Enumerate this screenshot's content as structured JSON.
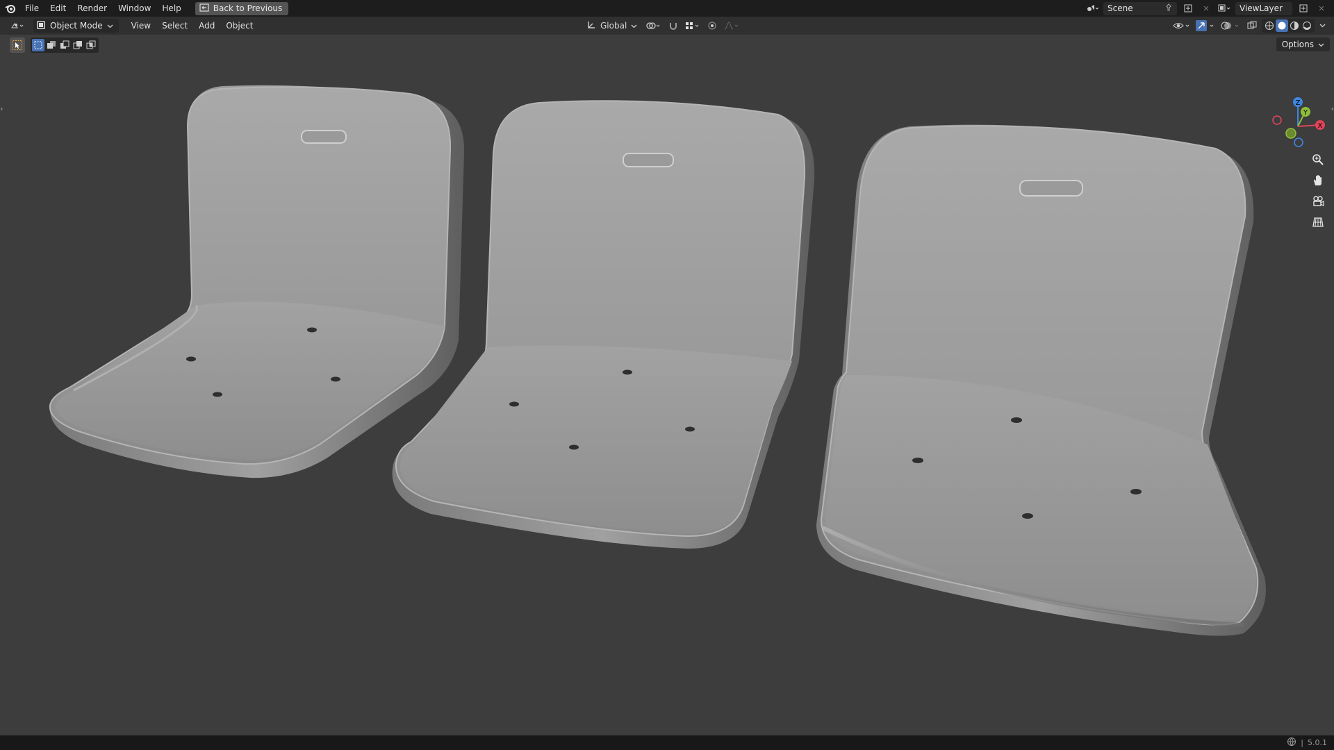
{
  "menu": {
    "items": [
      "File",
      "Edit",
      "Render",
      "Window",
      "Help"
    ],
    "back_button": "Back to Previous"
  },
  "top_right": {
    "scene": "Scene",
    "view_layer": "ViewLayer"
  },
  "header": {
    "mode": "Object Mode",
    "menus": [
      "View",
      "Select",
      "Add",
      "Object"
    ],
    "transform_orientation": "Global"
  },
  "toolbar": {
    "options": "Options"
  },
  "viewport": {
    "objects": [
      "seat-shell-1",
      "seat-shell-2",
      "seat-shell-3"
    ],
    "gizmo_axes": [
      "X",
      "Y",
      "Z"
    ]
  },
  "status": {
    "version": "5.0.1"
  },
  "colors": {
    "accent": "#4772b3",
    "axis_x": "#e0445a",
    "axis_y": "#8fbf3a",
    "axis_z": "#3f86e0",
    "viewport_bg": "#3d3d3d"
  }
}
